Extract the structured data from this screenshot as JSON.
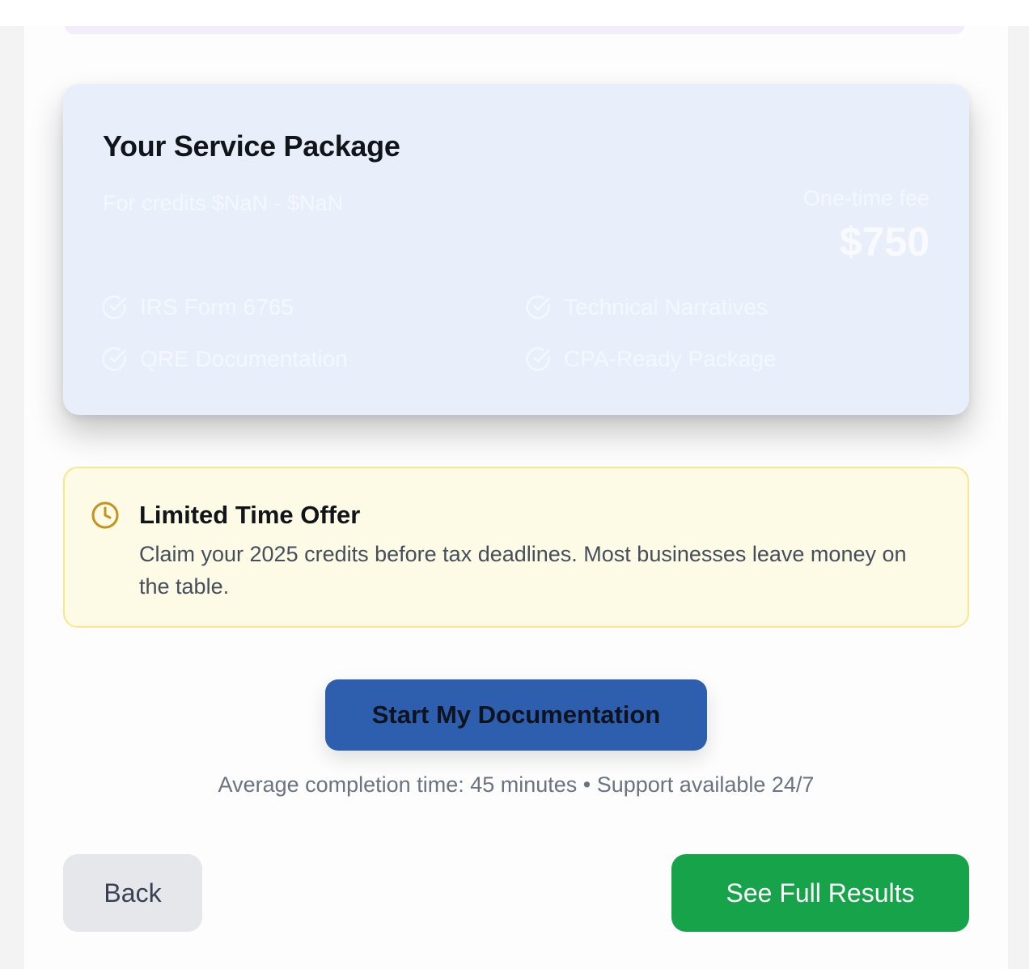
{
  "package": {
    "title": "Your Service Package",
    "subtitle": "For credits $NaN - $NaN",
    "fee_label": "One-time fee",
    "fee_amount": "$750",
    "features": [
      {
        "label": "IRS Form 6765",
        "icon": "check-circle-icon"
      },
      {
        "label": "Technical Narratives",
        "icon": "check-circle-icon"
      },
      {
        "label": "QRE Documentation",
        "icon": "check-circle-icon"
      },
      {
        "label": "CPA-Ready Package",
        "icon": "check-circle-icon"
      }
    ]
  },
  "offer": {
    "icon": "clock-icon",
    "title": "Limited Time Offer",
    "text": "Claim your 2025 credits before tax deadlines. Most businesses leave money on the table."
  },
  "cta": {
    "start_label": "Start My Documentation",
    "note": "Average completion time: 45 minutes • Support available 24/7"
  },
  "nav": {
    "back_label": "Back",
    "results_label": "See Full Results"
  },
  "colors": {
    "card_bg": "#e8effb",
    "offer_bg": "#fdfae6",
    "offer_border": "#f7e98a",
    "offer_icon": "#c8921a",
    "primary": "#2e5fae",
    "success": "#17a34a",
    "secondary": "#e5e7eb"
  }
}
